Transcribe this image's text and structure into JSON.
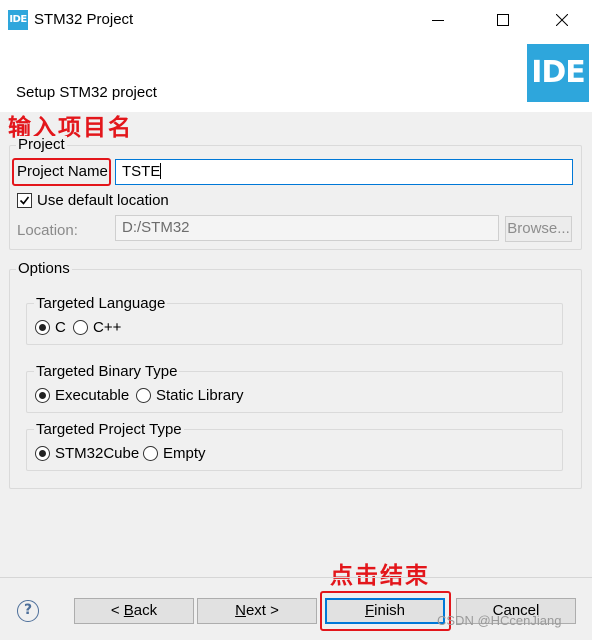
{
  "window": {
    "app_icon_text": "IDE",
    "title": "STM32 Project",
    "minimize_icon": "minimize-icon",
    "maximize_icon": "maximize-icon",
    "close_icon": "close-icon"
  },
  "header": {
    "title": "Setup STM32 project",
    "logo_text": "IDE",
    "logo_color": "#2ea6dc"
  },
  "annotations": {
    "enter_name": "输入项目名",
    "click_finish": "点击结束",
    "color": "#e3161b"
  },
  "project_group": {
    "title": "Project",
    "name_label": "Project Name",
    "name_value": "TSTE",
    "use_default_location_label": "Use default location",
    "use_default_location_checked": true,
    "location_label": "Location:",
    "location_value": "D:/STM32",
    "browse_label": "Browse..."
  },
  "options_group": {
    "title": "Options",
    "language": {
      "title": "Targeted Language",
      "options": [
        "C",
        "C++"
      ],
      "selected": "C"
    },
    "binary_type": {
      "title": "Targeted Binary Type",
      "options": [
        "Executable",
        "Static Library"
      ],
      "selected": "Executable"
    },
    "project_type": {
      "title": "Targeted Project Type",
      "options": [
        "STM32Cube",
        "Empty"
      ],
      "selected": "STM32Cube"
    }
  },
  "footer": {
    "help_icon": "help-icon",
    "back_prefix": "< ",
    "back_mnemonic": "B",
    "back_rest": "ack",
    "next_mnemonic": "N",
    "next_rest": "ext >",
    "finish_mnemonic": "F",
    "finish_rest": "inish",
    "cancel_label": "Cancel",
    "watermark": "CSDN @HCcenJiang"
  }
}
